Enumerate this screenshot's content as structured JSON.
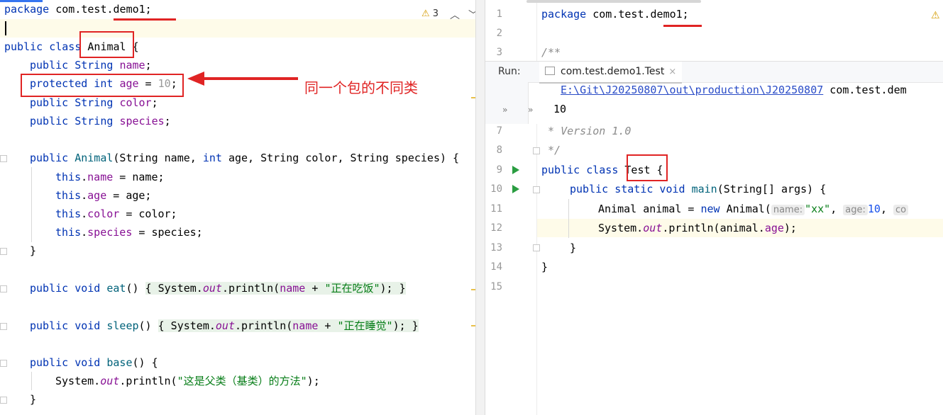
{
  "left_editor": {
    "inspections": {
      "warning_count": "3",
      "up": "^",
      "down": "v"
    },
    "lines": {
      "l1": {
        "kw": "package",
        "rest": " com.test.demo1;"
      },
      "l3a": "public class ",
      "l3b": "Animal",
      "l3c": " {",
      "l4a": "public String ",
      "l4b": "name",
      "l4c": ";",
      "l5a": "protected int ",
      "l5b": "age",
      "l5c": " = ",
      "l5d": "10",
      "l5e": ";",
      "l6a": "public String ",
      "l6b": "color",
      "l6c": ";",
      "l7a": "public String ",
      "l7b": "species",
      "l7c": ";",
      "l9a": "public ",
      "l9b": "Animal",
      "l9c": "(String name, ",
      "l9d": "int",
      "l9e": " age, String color, String species) {",
      "l10a": "this",
      "l10b": ".",
      "l10c": "name",
      "l10d": " = name;",
      "l11a": "this",
      "l11b": ".",
      "l11c": "age",
      "l11d": " = age;",
      "l12a": "this",
      "l12b": ".",
      "l12c": "color",
      "l12d": " = color;",
      "l13a": "this",
      "l13b": ".",
      "l13c": "species",
      "l13d": " = species;",
      "l14": "}",
      "l16a": "public void ",
      "l16b": "eat",
      "l16c": "() ",
      "l16d": "{ System.",
      "l16e": "out",
      "l16f": ".println(",
      "l16g": "name",
      "l16h": " + ",
      "l16i": "\"正在吃饭\"",
      "l16j": "); }",
      "l18a": "public void ",
      "l18b": "sleep",
      "l18c": "() ",
      "l18d": "{ System.",
      "l18e": "out",
      "l18f": ".println(",
      "l18g": "name",
      "l18h": " + ",
      "l18i": "\"正在睡觉\"",
      "l18j": "); }",
      "l20a": "public void ",
      "l20b": "base",
      "l20c": "() {",
      "l21a": "System.",
      "l21b": "out",
      "l21c": ".println(",
      "l21d": "\"这是父类（基类）的方法\"",
      "l21e": ");",
      "l22": "}"
    }
  },
  "annotation": {
    "text": "同一个包的不同类"
  },
  "right_editor": {
    "line_numbers": [
      "1",
      "2",
      "3",
      "7",
      "8",
      "9",
      "10",
      "11",
      "12",
      "13",
      "14",
      "15"
    ],
    "lines": {
      "r1a": "package",
      "r1b": " com.test.demo1;",
      "r3": "/**",
      "r7": " * Version 1.0",
      "r8": " */",
      "r9a": "public class ",
      "r9b": "Test",
      "r9c": " {",
      "r10a": "public static void ",
      "r10b": "main",
      "r10c": "(String[] args) {",
      "r11a": "Animal animal = ",
      "r11b": "new",
      "r11c": " Animal(",
      "r11h1": "name:",
      "r11d": "\"xx\"",
      "r11e": ", ",
      "r11h2": "age:",
      "r11f": "10",
      "r11g": ", ",
      "r11h3": "co",
      "r12a": "System.",
      "r12b": "out",
      "r12c": ".println(animal.",
      "r12d": "age",
      "r12e": ");",
      "r13": "}",
      "r14": "}"
    }
  },
  "run_panel": {
    "label": "Run:",
    "tab": "com.test.demo1.Test",
    "close": "×",
    "cmd_path": "E:\\Git\\J20250807\\out\\production\\J20250807",
    "cmd_rest": " com.test.dem",
    "output": "10",
    "chev": "»"
  }
}
